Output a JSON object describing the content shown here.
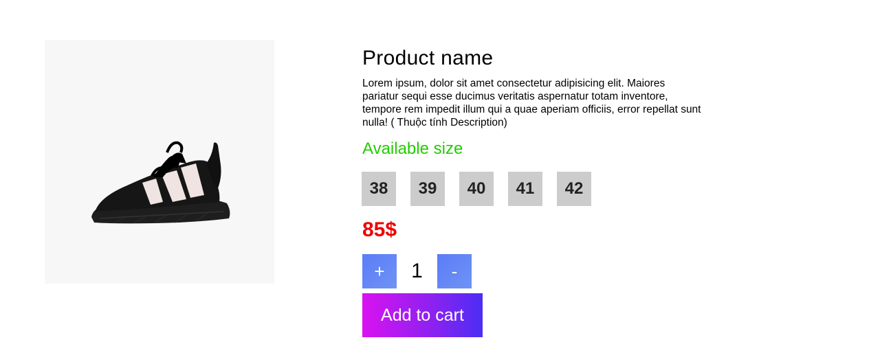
{
  "product": {
    "name": "Product name",
    "description": "Lorem ipsum, dolor sit amet consectetur adipisicing elit. Maiores pariatur sequi esse ducimus veritatis aspernatur totam inventore, tempore rem impedit illum qui a quae aperiam officiis, error repellat sunt nulla! ( Thuộc tính Description)",
    "image_icon": "sneaker-image",
    "available_size_label": "Available size",
    "sizes": [
      "38",
      "39",
      "40",
      "41",
      "42"
    ],
    "price": "85$"
  },
  "quantity": {
    "increment_label": "+",
    "value": "1",
    "decrement_label": "-"
  },
  "cart": {
    "add_label": "Add to cart"
  },
  "colors": {
    "available_size": "#22cc00",
    "price": "#ee0000",
    "size_button_bg": "#cccccc",
    "qty_button_bg": "#6585f6",
    "add_to_cart_gradient_start": "#d813f0",
    "add_to_cart_gradient_end": "#4b2ef5"
  }
}
